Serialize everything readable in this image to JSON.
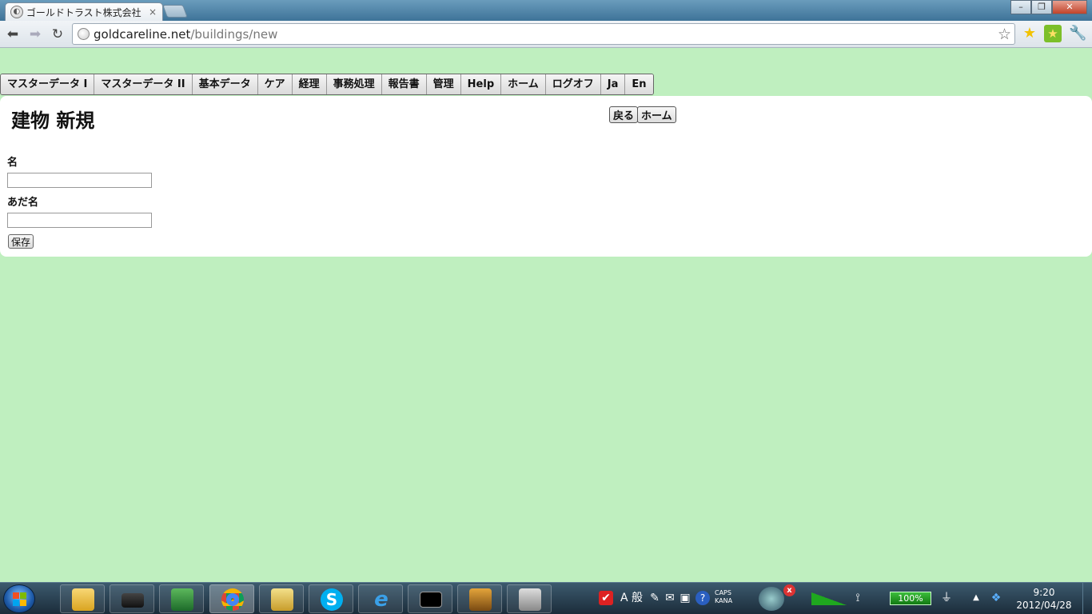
{
  "browser": {
    "tab_title": "ゴールドトラスト株式会社",
    "tab_close": "×",
    "url_host": "goldcareline.net",
    "url_path": "/buildings/new",
    "window_buttons": [
      "–",
      "❐",
      "✕"
    ]
  },
  "nav": {
    "items": [
      "マスターデータ I",
      "マスターデータ II",
      "基本データ",
      "ケア",
      "経理",
      "事務処理",
      "報告書",
      "管理",
      "Help",
      "ホーム",
      "ログオフ",
      "Ja",
      "En"
    ]
  },
  "page": {
    "title": "建物 新規",
    "back_label": "戻る",
    "home_label": "ホーム",
    "name_label": "名",
    "nickname_label": "あだ名",
    "save_label": "保存"
  },
  "taskbar": {
    "ime": "A 般",
    "caps": "CAPS",
    "kana": "KANA",
    "battery": "100%",
    "time": "9:20",
    "date": "2012/04/28",
    "badge": "x"
  },
  "colors": {
    "page_background": "#bfefbf",
    "panel": "#ffffff"
  }
}
